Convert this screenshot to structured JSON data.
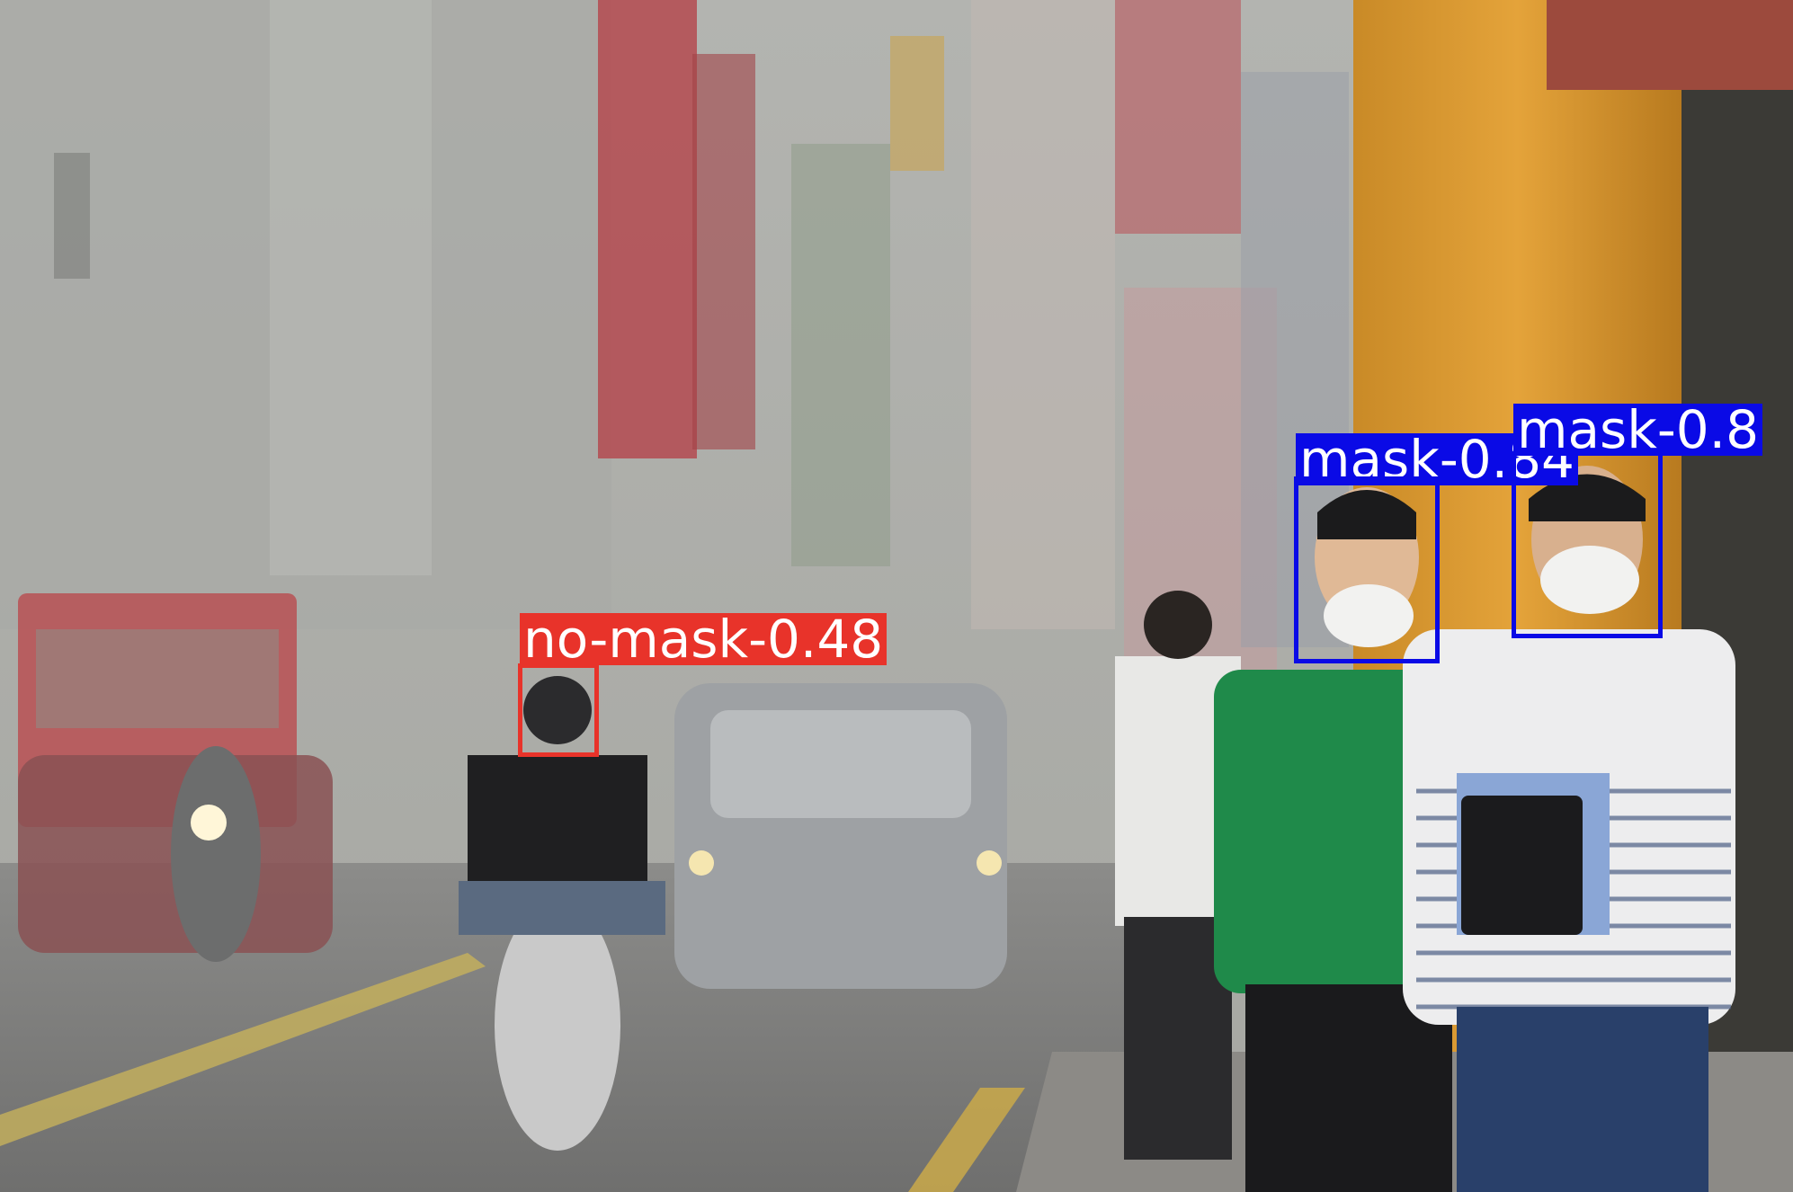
{
  "image": {
    "description_items": [
      "hazy city street",
      "pedestrians",
      "motorcyclists",
      "cars",
      "bus",
      "storefronts"
    ]
  },
  "detections": [
    {
      "label": "no-mask-0.48",
      "class": "no-mask",
      "color": "#e8332a"
    },
    {
      "label": "mask-0.84",
      "class": "mask",
      "color": "#0a0ae6"
    },
    {
      "label": "mask-0.8",
      "class": "mask",
      "color": "#0a0ae6"
    }
  ]
}
